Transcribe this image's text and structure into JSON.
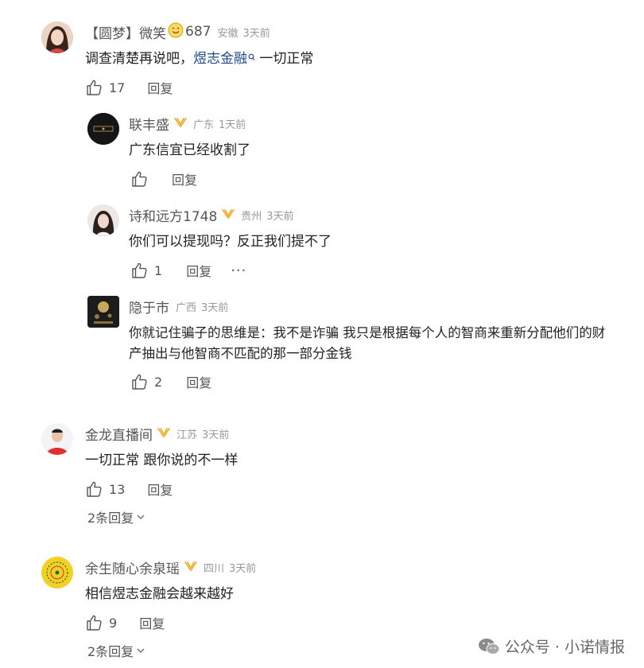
{
  "comments": [
    {
      "user": "【圆梦】微笑",
      "user_suffix": "687",
      "location": "安徽",
      "time": "3天前",
      "text_before": "调查清楚再说吧，",
      "link": "煜志金融",
      "text_after": " 一切正常",
      "likes": "17",
      "reply_label": "回复",
      "replies": [
        {
          "user": "联丰盛",
          "location": "广东",
          "time": "1天前",
          "text": "广东信宜已经收割了",
          "likes": "",
          "reply_label": "回复"
        },
        {
          "user": "诗和远方1748",
          "location": "贵州",
          "time": "3天前",
          "text": "你们可以提现吗？反正我们提不了",
          "likes": "1",
          "reply_label": "回复",
          "more": "···"
        },
        {
          "user": "隐于市",
          "location": "广西",
          "time": "3天前",
          "text_line1": "你就记住骗子的思维是：我不是诈骗 我只是根据每个人的智商来重新分配他们的财",
          "text_line2": "产抽出与他智商不匹配的那一部分金钱",
          "likes": "2",
          "reply_label": "回复"
        }
      ]
    },
    {
      "user": "金龙直播间",
      "location": "江苏",
      "time": "3天前",
      "text": "一切正常 跟你说的不一样",
      "likes": "13",
      "reply_label": "回复",
      "expand": "2条回复"
    },
    {
      "user": "余生随心余泉瑶",
      "location": "四川",
      "time": "3天前",
      "text": "相信煜志金融会越来越好",
      "likes": "9",
      "reply_label": "回复",
      "expand": "2条回复"
    }
  ],
  "watermark": {
    "text": "公众号 · 小诺情报",
    "icon": "wechat-icon"
  },
  "colors": {
    "link": "#1e4d8b",
    "badge": "#f5a623",
    "muted": "#999999",
    "text": "#222222"
  }
}
